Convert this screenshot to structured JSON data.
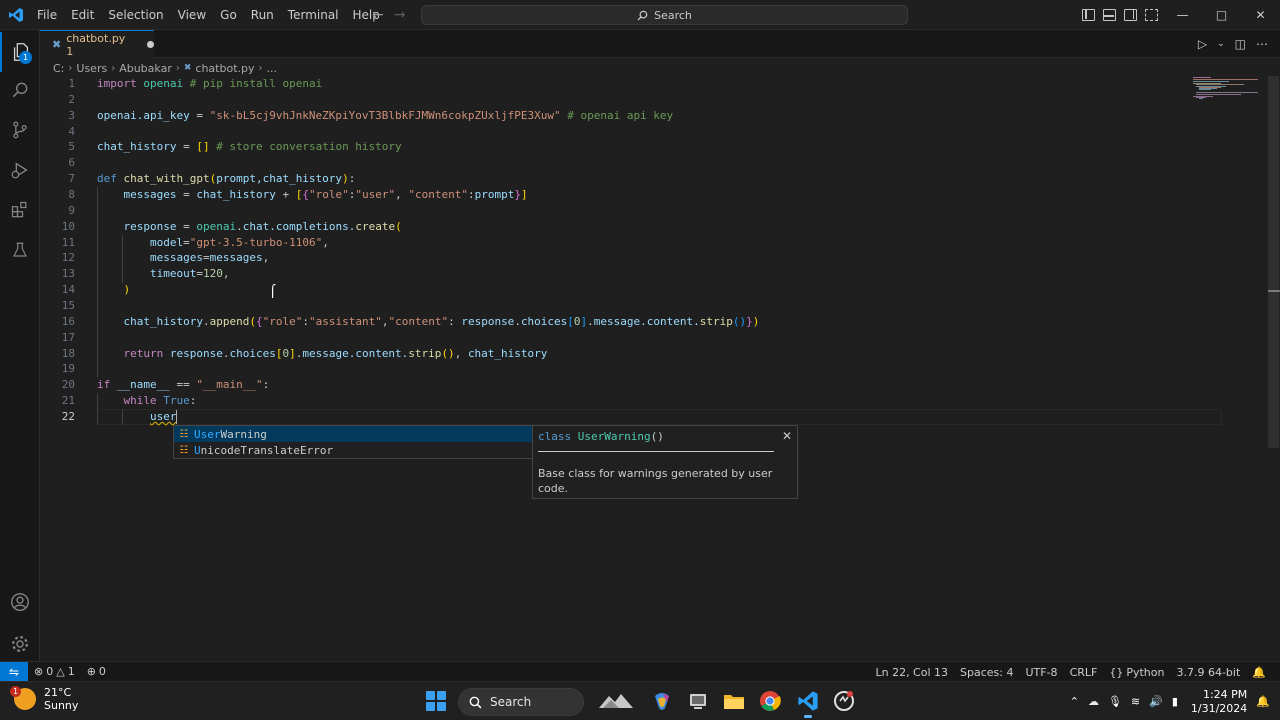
{
  "menu": [
    "File",
    "Edit",
    "Selection",
    "View",
    "Go",
    "Run",
    "Terminal",
    "Help"
  ],
  "command_center": {
    "placeholder": "Search"
  },
  "activity_bar": {
    "explorer_badge": "1"
  },
  "tab": {
    "label": "chatbot.py 1",
    "dirty": true
  },
  "breadcrumb": [
    "C:",
    "Users",
    "Abubakar",
    "chatbot.py",
    "..."
  ],
  "editor": {
    "line_numbers": [
      "1",
      "2",
      "3",
      "4",
      "5",
      "6",
      "7",
      "8",
      "9",
      "10",
      "11",
      "12",
      "13",
      "14",
      "15",
      "16",
      "17",
      "18",
      "19",
      "20",
      "21",
      "22"
    ],
    "current_line": 22,
    "lines": {
      "l1": {
        "kw": "import",
        "mod": "openai",
        "comment": "# pip install openai"
      },
      "l3": {
        "var": "openai.api_key",
        "op": "=",
        "str": "\"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\"",
        "comment": "# openai api key"
      },
      "l5": {
        "var": "chat_history",
        "op": "=",
        "brackets": "[]",
        "comment": "# store conversation history"
      },
      "l7": {
        "kw": "def",
        "fn": "chat_with_gpt",
        "params": "prompt,chat_history"
      },
      "l8": {
        "var": "messages",
        "rhs": "chat_history",
        "s1": "\"role\"",
        "s2": "\"user\"",
        "s3": "\"content\"",
        "v": "prompt"
      },
      "l10": {
        "var": "response",
        "obj": "openai",
        "chain": "chat.completions.",
        "fn": "create"
      },
      "l11": {
        "arg": "model",
        "str": "\"gpt-3.5-turbo-1106\""
      },
      "l12": {
        "arg": "messages",
        "val": "messages"
      },
      "l13": {
        "arg": "timeout",
        "num": "120"
      },
      "l14": {
        "paren": ")"
      },
      "l16": {
        "obj": "chat_history",
        "fn": "append",
        "s1": "\"role\"",
        "s2": "\"assistant\"",
        "s3": "\"content\"",
        "v": "response",
        "attr": "choices",
        "idx": "0",
        "tail": "message.content.",
        "fn2": "strip"
      },
      "l18": {
        "kw": "return",
        "v": "response",
        "attr": "choices",
        "idx": "0",
        "tail": "message.content.",
        "fn2": "strip",
        "ret2": "chat_history"
      },
      "l20": {
        "kw": "if",
        "var": "__name__",
        "op": "==",
        "str": "\"__main__\""
      },
      "l21": {
        "kw": "while",
        "const": "True"
      },
      "l22": {
        "typed": "user"
      }
    }
  },
  "suggest": {
    "items": [
      {
        "match": "User",
        "rest": "Warning",
        "selected": true
      },
      {
        "match": "U",
        "rest": "nicodeTranslateError",
        "selected": false
      }
    ],
    "details": {
      "sig_prefix": "class",
      "sig_name": "UserWarning",
      "sig_suffix": "()",
      "doc": "Base class for warnings generated by user code."
    }
  },
  "status_bar": {
    "errors": "0",
    "warnings": "1",
    "ports": "0",
    "position": "Ln 22, Col 13",
    "spaces": "Spaces: 4",
    "encoding": "UTF-8",
    "eol": "CRLF",
    "language": "Python",
    "interpreter": "3.7.9 64-bit"
  },
  "taskbar": {
    "weather_temp": "21°C",
    "weather_desc": "Sunny",
    "weather_badge": "1",
    "search_label": "Search",
    "time": "1:24 PM",
    "date": "1/31/2024"
  },
  "colors": {
    "accent": "#0078d4",
    "keyword": "#c586c0",
    "string": "#ce9178",
    "comment": "#6a9955",
    "function": "#dcdcaa",
    "variable": "#9cdcfe"
  }
}
